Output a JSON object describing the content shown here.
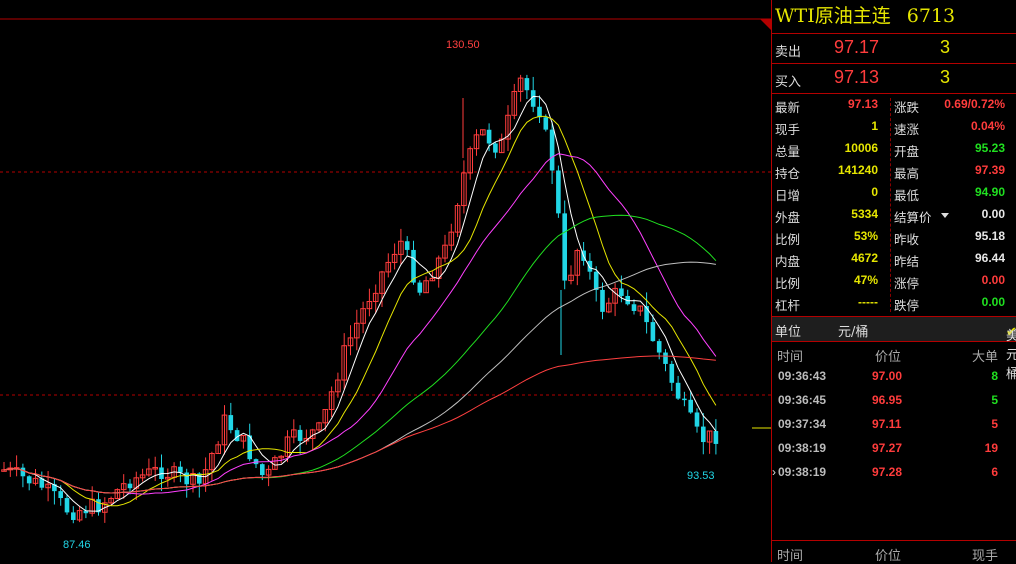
{
  "instrument": {
    "name": "WTI原油主连",
    "code": "6713"
  },
  "order_book": {
    "sell": {
      "label": "卖出",
      "price": "97.17",
      "volume": "3"
    },
    "buy": {
      "label": "买入",
      "price": "97.13",
      "volume": "3"
    }
  },
  "quote": [
    {
      "left_label": "最新",
      "left_value": "97.13",
      "left_color": "red",
      "right_label": "涨跌",
      "right_value": "0.69/0.72%",
      "right_color": "red"
    },
    {
      "left_label": "现手",
      "left_value": "1",
      "left_color": "yellow",
      "right_label": "速涨",
      "right_value": "0.04%",
      "right_color": "red"
    },
    {
      "left_label": "总量",
      "left_value": "10006",
      "left_color": "yellow",
      "right_label": "开盘",
      "right_value": "95.23",
      "right_color": "green"
    },
    {
      "left_label": "持仓",
      "left_value": "141240",
      "left_color": "yellow",
      "right_label": "最高",
      "right_value": "97.39",
      "right_color": "red"
    },
    {
      "left_label": "日增",
      "left_value": "0",
      "left_color": "yellow",
      "right_label": "最低",
      "right_value": "94.90",
      "right_color": "green"
    },
    {
      "left_label": "外盘",
      "left_value": "5334",
      "left_color": "yellow",
      "right_label": "结算价",
      "right_value": "0.00",
      "right_color": "white"
    },
    {
      "left_label": "比例",
      "left_value": "53%",
      "left_color": "yellow",
      "right_label": "昨收",
      "right_value": "95.18",
      "right_color": "white"
    },
    {
      "left_label": "内盘",
      "left_value": "4672",
      "left_color": "yellow",
      "right_label": "昨结",
      "right_value": "96.44",
      "right_color": "white"
    },
    {
      "left_label": "比例",
      "left_value": "47%",
      "left_color": "yellow",
      "right_label": "涨停",
      "right_value": "0.00",
      "right_color": "red"
    },
    {
      "left_label": "杠杆",
      "left_value": "-----",
      "left_color": "yellow",
      "right_label": "跌停",
      "right_value": "0.00",
      "right_color": "green"
    }
  ],
  "unit": {
    "label": "单位",
    "value": "元/桶",
    "option": "美元/桶"
  },
  "ticks_header": {
    "time": "时间",
    "price": "价位",
    "volume": "大单"
  },
  "ticks": [
    {
      "time": "09:36:43",
      "price": "97.00",
      "volume": "8",
      "vol_color": "green",
      "marker": ""
    },
    {
      "time": "09:36:45",
      "price": "96.95",
      "volume": "5",
      "vol_color": "green",
      "marker": ""
    },
    {
      "time": "09:37:34",
      "price": "97.11",
      "volume": "5",
      "vol_color": "red",
      "marker": ""
    },
    {
      "time": "09:38:19",
      "price": "97.27",
      "volume": "19",
      "vol_color": "red",
      "marker": ""
    },
    {
      "time": "09:38:19",
      "price": "97.28",
      "volume": "6",
      "vol_color": "red",
      "marker": "›"
    }
  ],
  "ticks2_header": {
    "time": "时间",
    "price": "价位",
    "volume": "现手"
  },
  "chart": {
    "high_label": "130.50",
    "low_label": "93.53",
    "prior_low_label": "87.46"
  },
  "colors": {
    "up": "#ff3c3c",
    "down": "#21d6e6",
    "ma5": "#ffffff",
    "ma10": "#e6e600",
    "ma20": "#ff40ff",
    "ma40": "#20e020",
    "ma60": "#c0c0c0",
    "ma120": "#ff4040",
    "grid": "#b40000"
  }
}
